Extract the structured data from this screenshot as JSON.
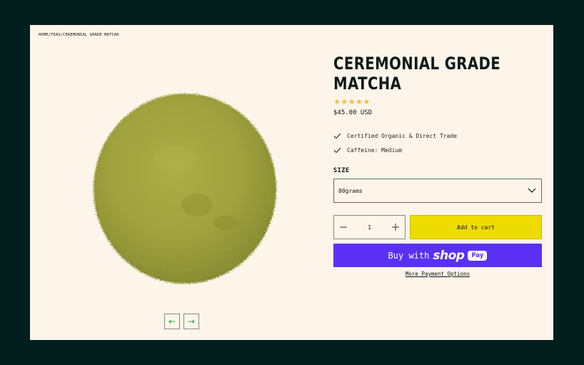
{
  "breadcrumb": {
    "home": "HOME",
    "sep1": "/",
    "teas": "TEAS",
    "sep2": "/",
    "current": "CEREMONIAL GRADE MATCHA"
  },
  "product": {
    "title_line1": "CEREMONIAL GRADE",
    "title_line2": "MATCHA",
    "rating": 5,
    "stars": "★★★★★",
    "price": "$45.00 USD",
    "features": [
      "Certified Organic & Direct Trade",
      "Caffeine: Medium"
    ],
    "image_icon": "matcha-powder-mound"
  },
  "size": {
    "label": "SIZE",
    "selected": "80grams"
  },
  "quantity": {
    "value": "1"
  },
  "buttons": {
    "add_to_cart": "Add to cart",
    "buy_with": "Buy with",
    "shop_brand": "shop",
    "pay_badge": "Pay",
    "more_payment": "More Payment Options"
  },
  "gallery": {
    "prev_icon": "←",
    "next_icon": "→"
  },
  "colors": {
    "background": "#031f1d",
    "page": "#fdf5ea",
    "accent_yellow": "#eedc00",
    "shop_purple": "#5a31f4",
    "star": "#e3c33d",
    "matcha": "#a4a83c",
    "arrow_green": "#1fa83a"
  }
}
